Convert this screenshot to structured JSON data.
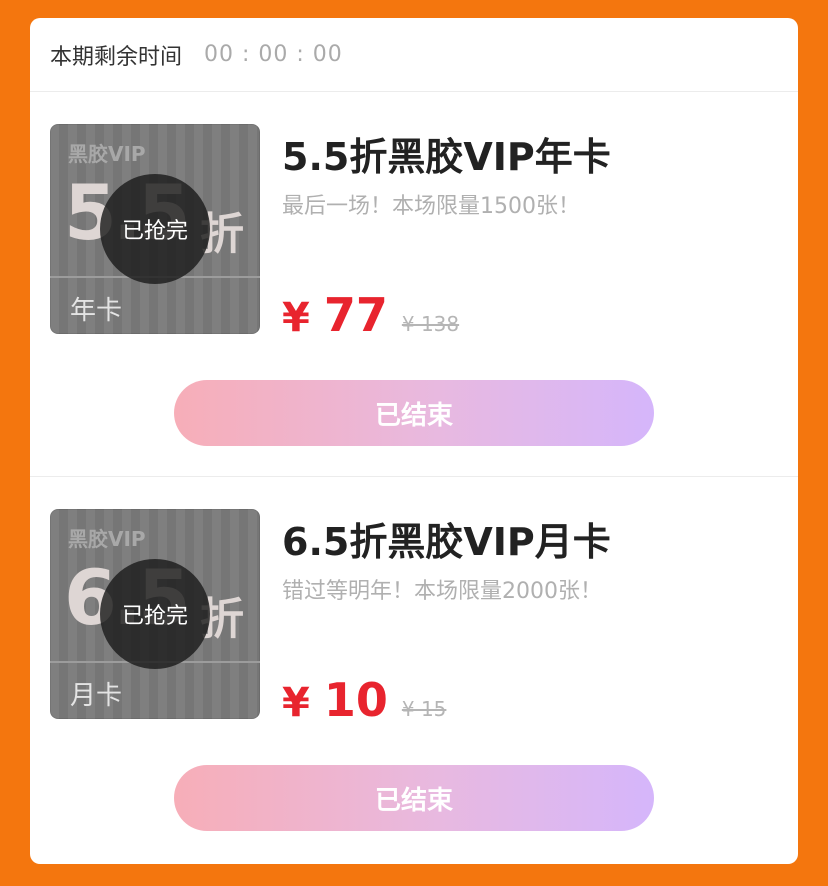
{
  "header": {
    "label": "本期剩余时间",
    "timer": "00 : 00 : 00"
  },
  "items": [
    {
      "ticket": {
        "brand": "黑胶VIP",
        "discount": "5.5",
        "discount_unit": "折",
        "type": "年卡"
      },
      "badge": "已抢完",
      "title": "5.5折黑胶VIP年卡",
      "desc": "最后一场！本场限量1500张！",
      "price_symbol": "¥",
      "price": "77",
      "original_price": "¥ 138",
      "button": "已结束"
    },
    {
      "ticket": {
        "brand": "黑胶VIP",
        "discount": "6.5",
        "discount_unit": "折",
        "type": "月卡"
      },
      "badge": "已抢完",
      "title": "6.5折黑胶VIP月卡",
      "desc": "错过等明年！本场限量2000张！",
      "price_symbol": "¥",
      "price": "10",
      "original_price": "¥ 15",
      "button": "已结束"
    }
  ],
  "colors": {
    "background": "#f4760e",
    "price": "#e8242e",
    "button_start": "#f7aeb8",
    "button_end": "#d5b6fb"
  }
}
